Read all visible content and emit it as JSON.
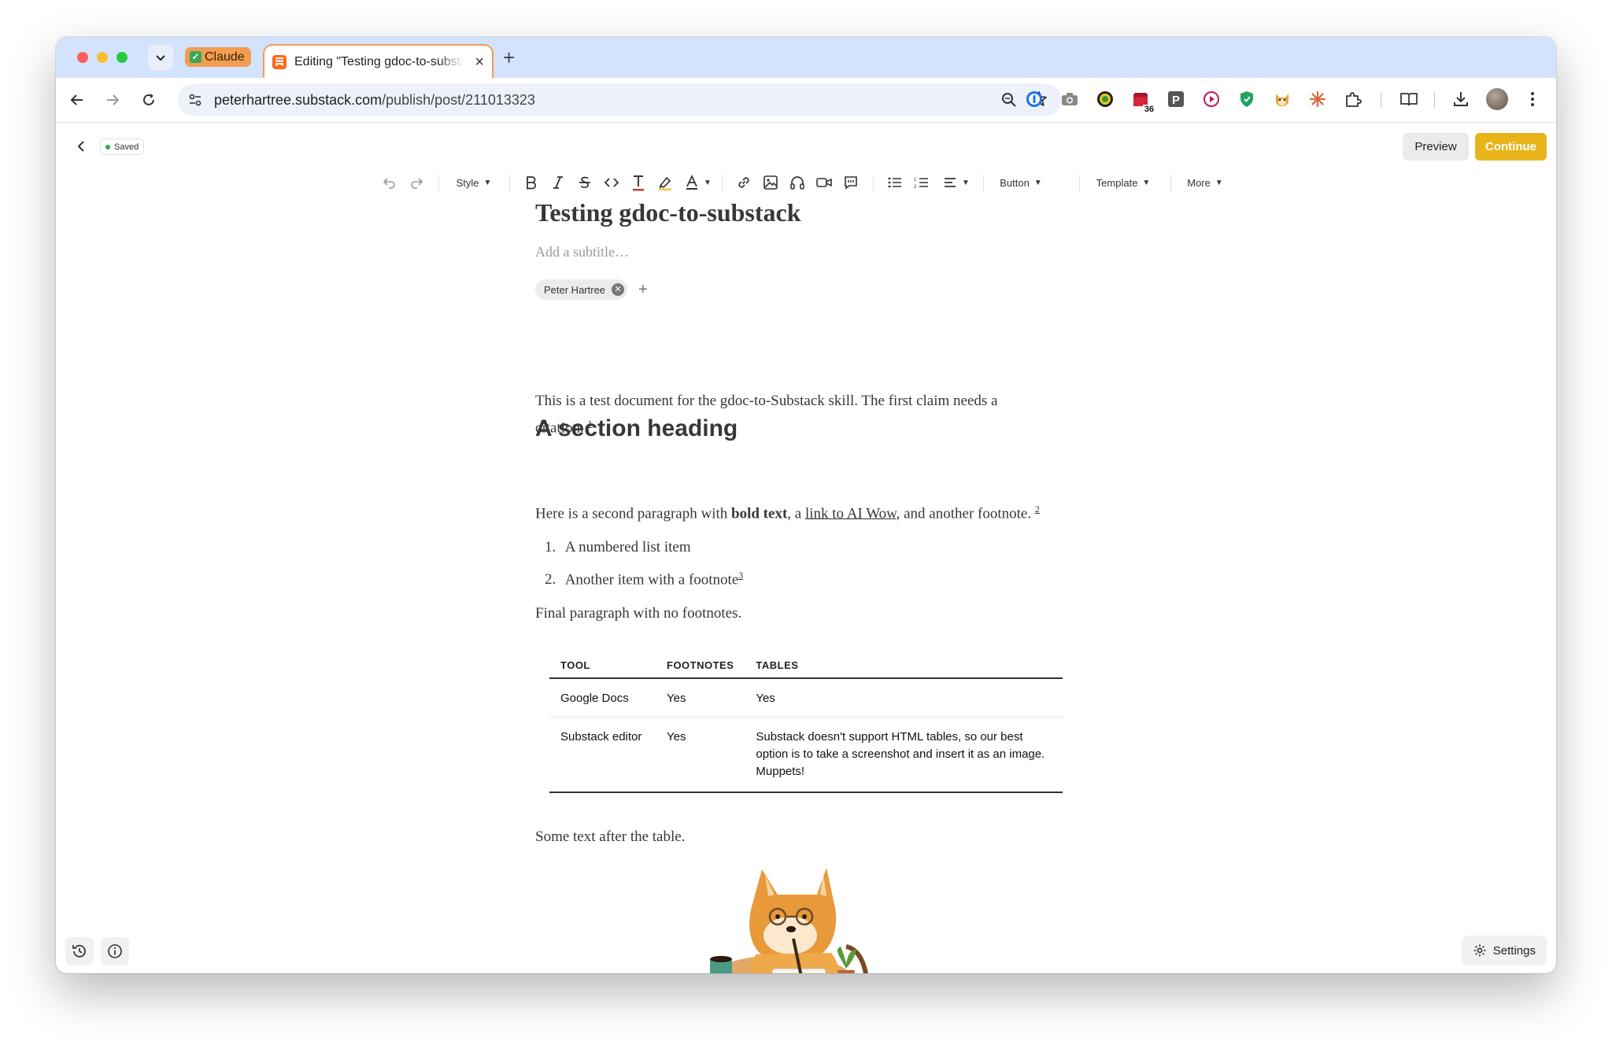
{
  "browser": {
    "tab_group_label": "Claude",
    "active_tab_title": "Editing \"Testing gdoc-to-substack\"",
    "url_host": "peterhartree.substack.com",
    "url_path": "/publish/post/211013323",
    "extension_badge": "36"
  },
  "editor": {
    "status": "Saved",
    "preview_label": "Preview",
    "continue_label": "Continue",
    "settings_label": "Settings",
    "toolbar": {
      "style_label": "Style",
      "button_label": "Button",
      "template_label": "Template",
      "more_label": "More"
    }
  },
  "post": {
    "title": "Testing gdoc-to-substack",
    "subtitle_placeholder": "Add a subtitle…",
    "author": "Peter Hartree",
    "intro_line1": "This is a test document for the gdoc-to-Substack skill. The first claim needs a",
    "intro_line2": "citation.",
    "fn1": "1",
    "heading": "A section heading",
    "p2_a": "Here is a second paragraph with ",
    "p2_bold": "bold text",
    "p2_b": ", a ",
    "p2_link": "link to AI Wow",
    "p2_c": ", and another footnote.",
    "fn2": "2",
    "list": [
      {
        "num": "1.",
        "text": "A numbered list item",
        "fn": ""
      },
      {
        "num": "2.",
        "text": "Another item with a footnote",
        "fn": "3"
      }
    ],
    "final_para": "Final paragraph with no footnotes.",
    "table": {
      "headers": [
        "TOOL",
        "FOOTNOTES",
        "TABLES"
      ],
      "rows": [
        [
          "Google Docs",
          "Yes",
          "Yes"
        ],
        [
          "Substack editor",
          "Yes",
          "Substack doesn't support HTML tables, so our best option is to take a screenshot and insert it as an image. Muppets!"
        ]
      ]
    },
    "after_table": "Some text after the table."
  },
  "colors": {
    "accent": "#e8b41a",
    "tab_strip": "#d3e3fd",
    "tab_group": "#f29d52",
    "saved_dot": "#22b14c"
  },
  "icons": [
    "search-icon",
    "star-icon",
    "back-icon",
    "forward-icon",
    "reload-icon",
    "undo-icon",
    "redo-icon",
    "bold-icon",
    "italic-icon",
    "strikethrough-icon",
    "code-icon",
    "text-color-icon",
    "highlighter-icon",
    "link-icon",
    "image-icon",
    "audio-icon",
    "video-icon",
    "comment-icon",
    "bullet-list-icon",
    "numbered-list-icon",
    "align-icon",
    "history-icon",
    "info-icon",
    "gear-icon"
  ]
}
